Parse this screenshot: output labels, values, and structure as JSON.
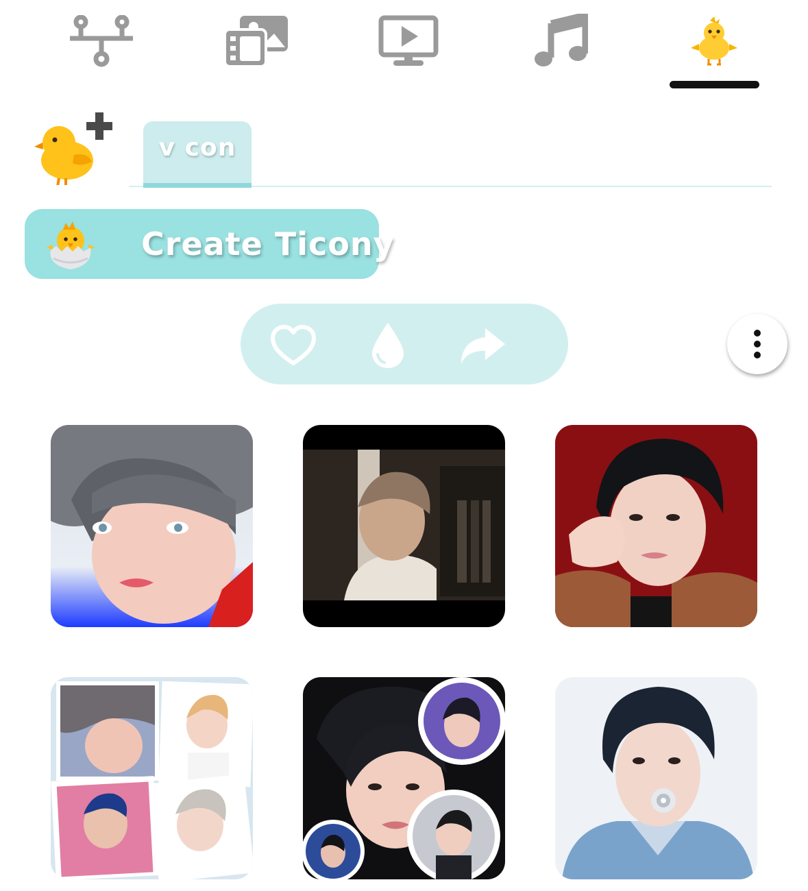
{
  "top_tabs": [
    {
      "icon": "network-icon",
      "selected": false
    },
    {
      "icon": "media-gallery-icon",
      "selected": false
    },
    {
      "icon": "video-screen-icon",
      "selected": false
    },
    {
      "icon": "music-note-icon",
      "selected": true
    },
    {
      "icon": "baby-chick-icon",
      "selected": true
    }
  ],
  "pack_tabs": [
    {
      "label": "v con",
      "selected": true
    }
  ],
  "add_pack": {
    "icon": "add-chick-icon"
  },
  "create_button": {
    "label": "Create Ticony",
    "icon": "hatching-chick-icon"
  },
  "actions": [
    {
      "icon": "heart-icon"
    },
    {
      "icon": "drop-icon"
    },
    {
      "icon": "share-arrow-icon"
    }
  ],
  "more_button": {
    "icon": "more-vertical-icon"
  },
  "stickers": [
    {
      "name": "sticker-portrait-grey-hair",
      "kind": "portrait"
    },
    {
      "name": "sticker-video-frame",
      "kind": "video"
    },
    {
      "name": "sticker-portrait-red-background",
      "kind": "portrait"
    },
    {
      "name": "sticker-collage",
      "kind": "collage"
    },
    {
      "name": "sticker-circle-collage",
      "kind": "collage"
    },
    {
      "name": "sticker-portrait-flower",
      "kind": "portrait"
    }
  ],
  "colors": {
    "accent": "#9ae1e1",
    "tab_bg": "#ccecee",
    "pill_bg": "#d2eff0",
    "icon_grey": "#9a9a9a",
    "underline": "#111111"
  }
}
